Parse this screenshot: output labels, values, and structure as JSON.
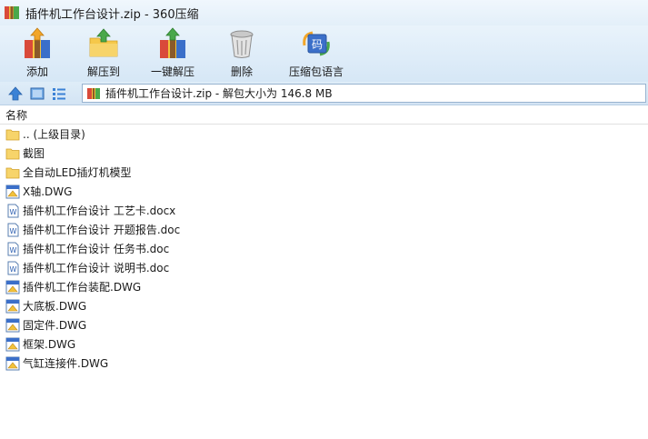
{
  "window": {
    "title": "插件机工作台设计.zip - 360压缩"
  },
  "toolbar": {
    "add_label": "添加",
    "extract_label": "解压到",
    "onekey_label": "一键解压",
    "delete_label": "删除",
    "language_label": "压缩包语言"
  },
  "address": {
    "text": "插件机工作台设计.zip - 解包大小为 146.8 MB"
  },
  "list": {
    "column_name": "名称",
    "items": [
      {
        "name": ".. (上级目录)",
        "icon": "folder-icon"
      },
      {
        "name": "截图",
        "icon": "folder-icon"
      },
      {
        "name": "全自动LED插灯机模型",
        "icon": "folder-icon"
      },
      {
        "name": "X轴.DWG",
        "icon": "dwg-file-icon"
      },
      {
        "name": "插件机工作台设计 工艺卡.docx",
        "icon": "word-file-icon"
      },
      {
        "name": "插件机工作台设计 开题报告.doc",
        "icon": "word-file-icon"
      },
      {
        "name": "插件机工作台设计 任务书.doc",
        "icon": "word-file-icon"
      },
      {
        "name": "插件机工作台设计 说明书.doc",
        "icon": "word-file-icon"
      },
      {
        "name": "插件机工作台装配.DWG",
        "icon": "dwg-file-icon"
      },
      {
        "name": "大底板.DWG",
        "icon": "dwg-file-icon"
      },
      {
        "name": "固定件.DWG",
        "icon": "dwg-file-icon"
      },
      {
        "name": "框架.DWG",
        "icon": "dwg-file-icon"
      },
      {
        "name": "气缸连接件.DWG",
        "icon": "dwg-file-icon"
      }
    ]
  }
}
